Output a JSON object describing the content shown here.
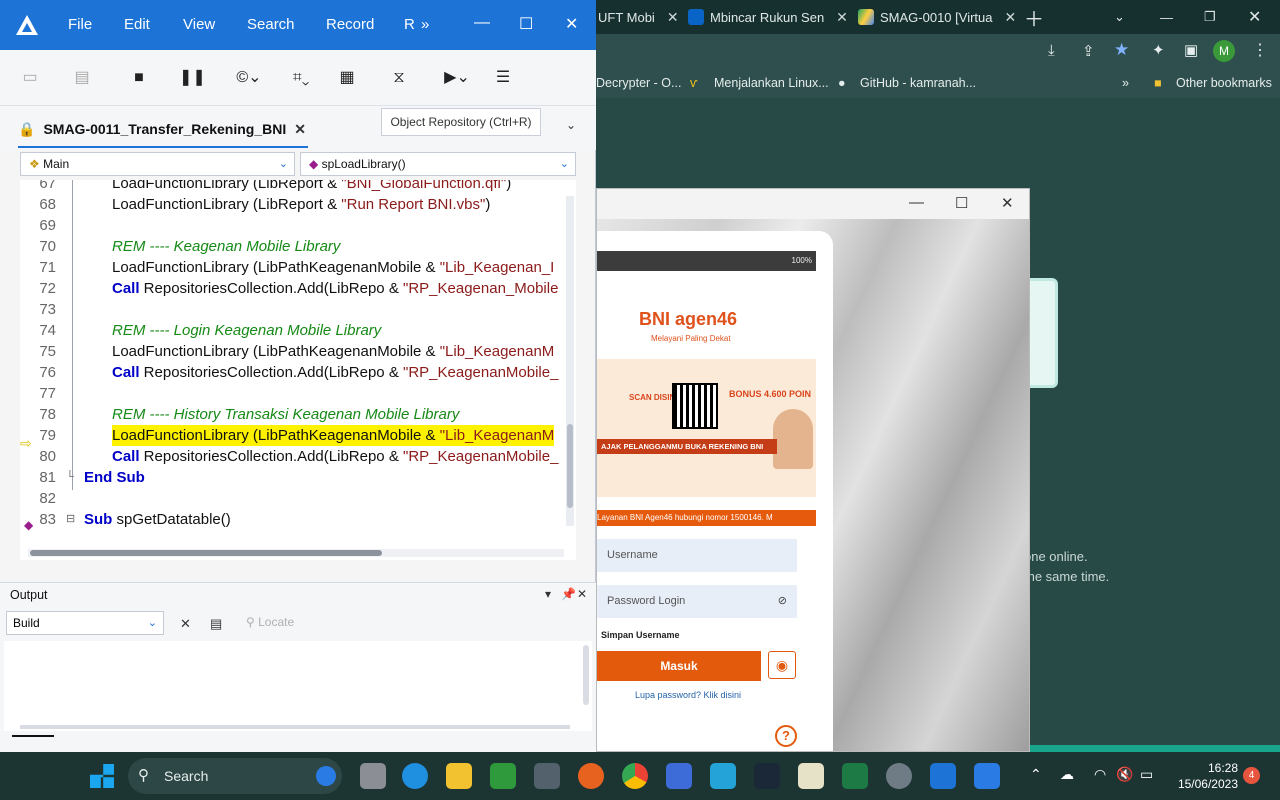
{
  "uft": {
    "menus": [
      "File",
      "Edit",
      "View",
      "Search",
      "Record",
      "R"
    ],
    "document_tab": "SMAG-0011_Transfer_Rekening_BNI",
    "tooltip": "Object Repository (Ctrl+R)",
    "scope_combo": "Main",
    "function_combo": "spLoadLibrary()",
    "code_lines": [
      {
        "num": "67",
        "parts": [
          [
            "t",
            "LoadFunctionLibrary (LibReport & "
          ],
          [
            "s",
            "\"BNI_GlobalFunction.qfl\""
          ],
          [
            "t",
            ")"
          ]
        ]
      },
      {
        "num": "68",
        "parts": [
          [
            "t",
            "LoadFunctionLibrary (LibReport & "
          ],
          [
            "s",
            "\"Run Report BNI.vbs\""
          ],
          [
            "t",
            ")"
          ]
        ]
      },
      {
        "num": "69",
        "parts": []
      },
      {
        "num": "70",
        "parts": [
          [
            "r",
            "REM ---- Keagenan Mobile Library"
          ]
        ]
      },
      {
        "num": "71",
        "parts": [
          [
            "t",
            "LoadFunctionLibrary (LibPathKeagenanMobile & "
          ],
          [
            "s",
            "\"Lib_Keagenan_I"
          ]
        ]
      },
      {
        "num": "72",
        "parts": [
          [
            "k",
            "Call"
          ],
          [
            "t",
            " RepositoriesCollection.Add(LibRepo & "
          ],
          [
            "s",
            "\"RP_Keagenan_Mobile"
          ]
        ]
      },
      {
        "num": "73",
        "parts": []
      },
      {
        "num": "74",
        "parts": [
          [
            "r",
            "REM ---- Login Keagenan Mobile Library"
          ]
        ]
      },
      {
        "num": "75",
        "parts": [
          [
            "t",
            "LoadFunctionLibrary (LibPathKeagenanMobile & "
          ],
          [
            "s",
            "\"Lib_KeagenanM"
          ]
        ]
      },
      {
        "num": "76",
        "parts": [
          [
            "k",
            "Call"
          ],
          [
            "t",
            " RepositoriesCollection.Add(LibRepo & "
          ],
          [
            "s",
            "\"RP_KeagenanMobile_"
          ]
        ]
      },
      {
        "num": "77",
        "parts": []
      },
      {
        "num": "78",
        "parts": [
          [
            "r",
            "REM ---- History Transaksi Keagenan Mobile Library"
          ]
        ]
      },
      {
        "num": "79",
        "parts": [
          [
            "t",
            "LoadFunctionLibrary (LibPathKeagenanMobile & "
          ],
          [
            "s",
            "\"Lib_KeagenanM"
          ]
        ],
        "highlight": true
      },
      {
        "num": "80",
        "parts": [
          [
            "k",
            "Call"
          ],
          [
            "t",
            " RepositoriesCollection.Add(LibRepo & "
          ],
          [
            "s",
            "\"RP_KeagenanMobile_"
          ]
        ]
      },
      {
        "num": "81",
        "parts": [
          [
            "k",
            "End Sub"
          ]
        ],
        "indent": 0
      },
      {
        "num": "82",
        "parts": []
      },
      {
        "num": "83",
        "parts": [
          [
            "k",
            "Sub"
          ],
          [
            "t",
            " spGetDatatable()"
          ]
        ],
        "indent": 0
      }
    ],
    "output_title": "Output",
    "output_combo": "Build",
    "locate_label": "Locate"
  },
  "chrome": {
    "tabs": [
      "UFT Mobi",
      "Mbincar Rukun Sen",
      "SMAG-0010 [Virtua"
    ],
    "bookmarks": [
      "Decrypter - O...",
      "Menjalankan Linux...",
      "GitHub - kamranah..."
    ],
    "other_bookmarks": "Other bookmarks",
    "bg_text_1": "one online.",
    "bg_text_2": "the same time.",
    "avatar_letter": "M"
  },
  "phone": {
    "brand": "BNI agen46",
    "tagline": "Melayani Paling Dekat",
    "banner_promo": "SCAN DISINI",
    "banner_bonus": "BONUS 4.600 POIN",
    "banner_cta": "AJAK PELANGGANMU BUKA REKENING BNI",
    "marquee": "Layanan BNI Agen46 hubungi nomor 1500146. M",
    "username_placeholder": "Username",
    "password_placeholder": "Password Login",
    "remember_label": "Simpan Username",
    "login_button": "Masuk",
    "forgot_link": "Lupa password? Klik disini",
    "status": "100%"
  },
  "taskbar": {
    "search": "Search",
    "time": "16:28",
    "date": "15/06/2023",
    "notifications": "4"
  },
  "colors": {
    "uft_blue": "#1d73d6",
    "highlight": "#fff200",
    "bni_orange": "#e35a0d"
  }
}
